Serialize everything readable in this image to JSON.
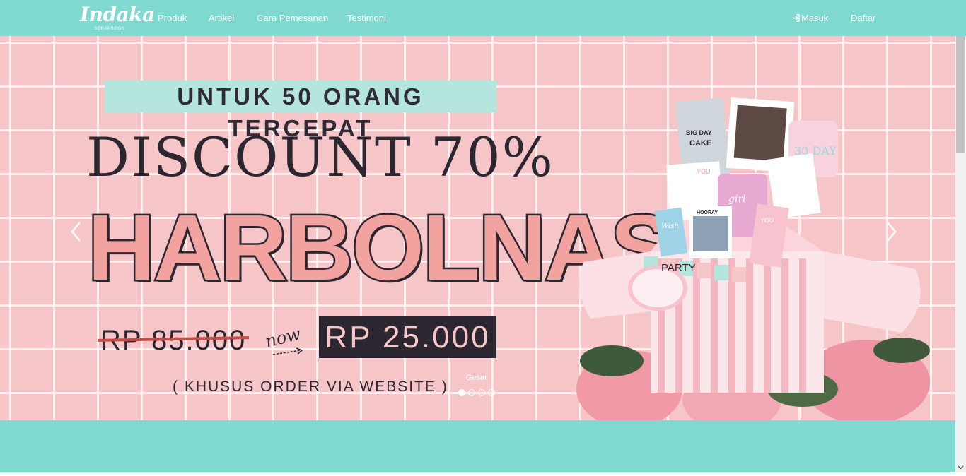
{
  "brand": {
    "logo_main": "Indaka",
    "logo_sub": "SCRAPBOOK"
  },
  "nav": {
    "links": [
      "Produk",
      "Artikel",
      "Cara Pemesanan",
      "Testimoni"
    ],
    "login": "Masuk",
    "register": "Daftar"
  },
  "slide": {
    "banner": "UNTUK 50 ORANG TERCEPAT",
    "discount": "DISCOUNT 70%",
    "headline": "HARBOLNAS",
    "old_price": "RP 85.000",
    "now_word": "now",
    "new_price": "RP 25.000",
    "note": "( KHUSUS ORDER VIA WEBSITE )",
    "art_labels": [
      "BIG DAY",
      "CAKE",
      "YOU",
      "girl",
      "HOORAY",
      "YOU",
      "Wish",
      "PARTY",
      "30 DAY"
    ]
  },
  "carousel": {
    "hint": "Geser",
    "slide_count": 4,
    "active_index": 0
  },
  "colors": {
    "navbar": "#7fd9d0",
    "banner_bg": "#b5e6dd",
    "slide_bg": "#f5c5c8",
    "ink": "#2c2630",
    "pink_fill": "#f2a3a0",
    "strike": "#c54a45"
  },
  "icons": {
    "login": "sign-in-icon",
    "prev": "chevron-left-icon",
    "next": "chevron-right-icon"
  }
}
